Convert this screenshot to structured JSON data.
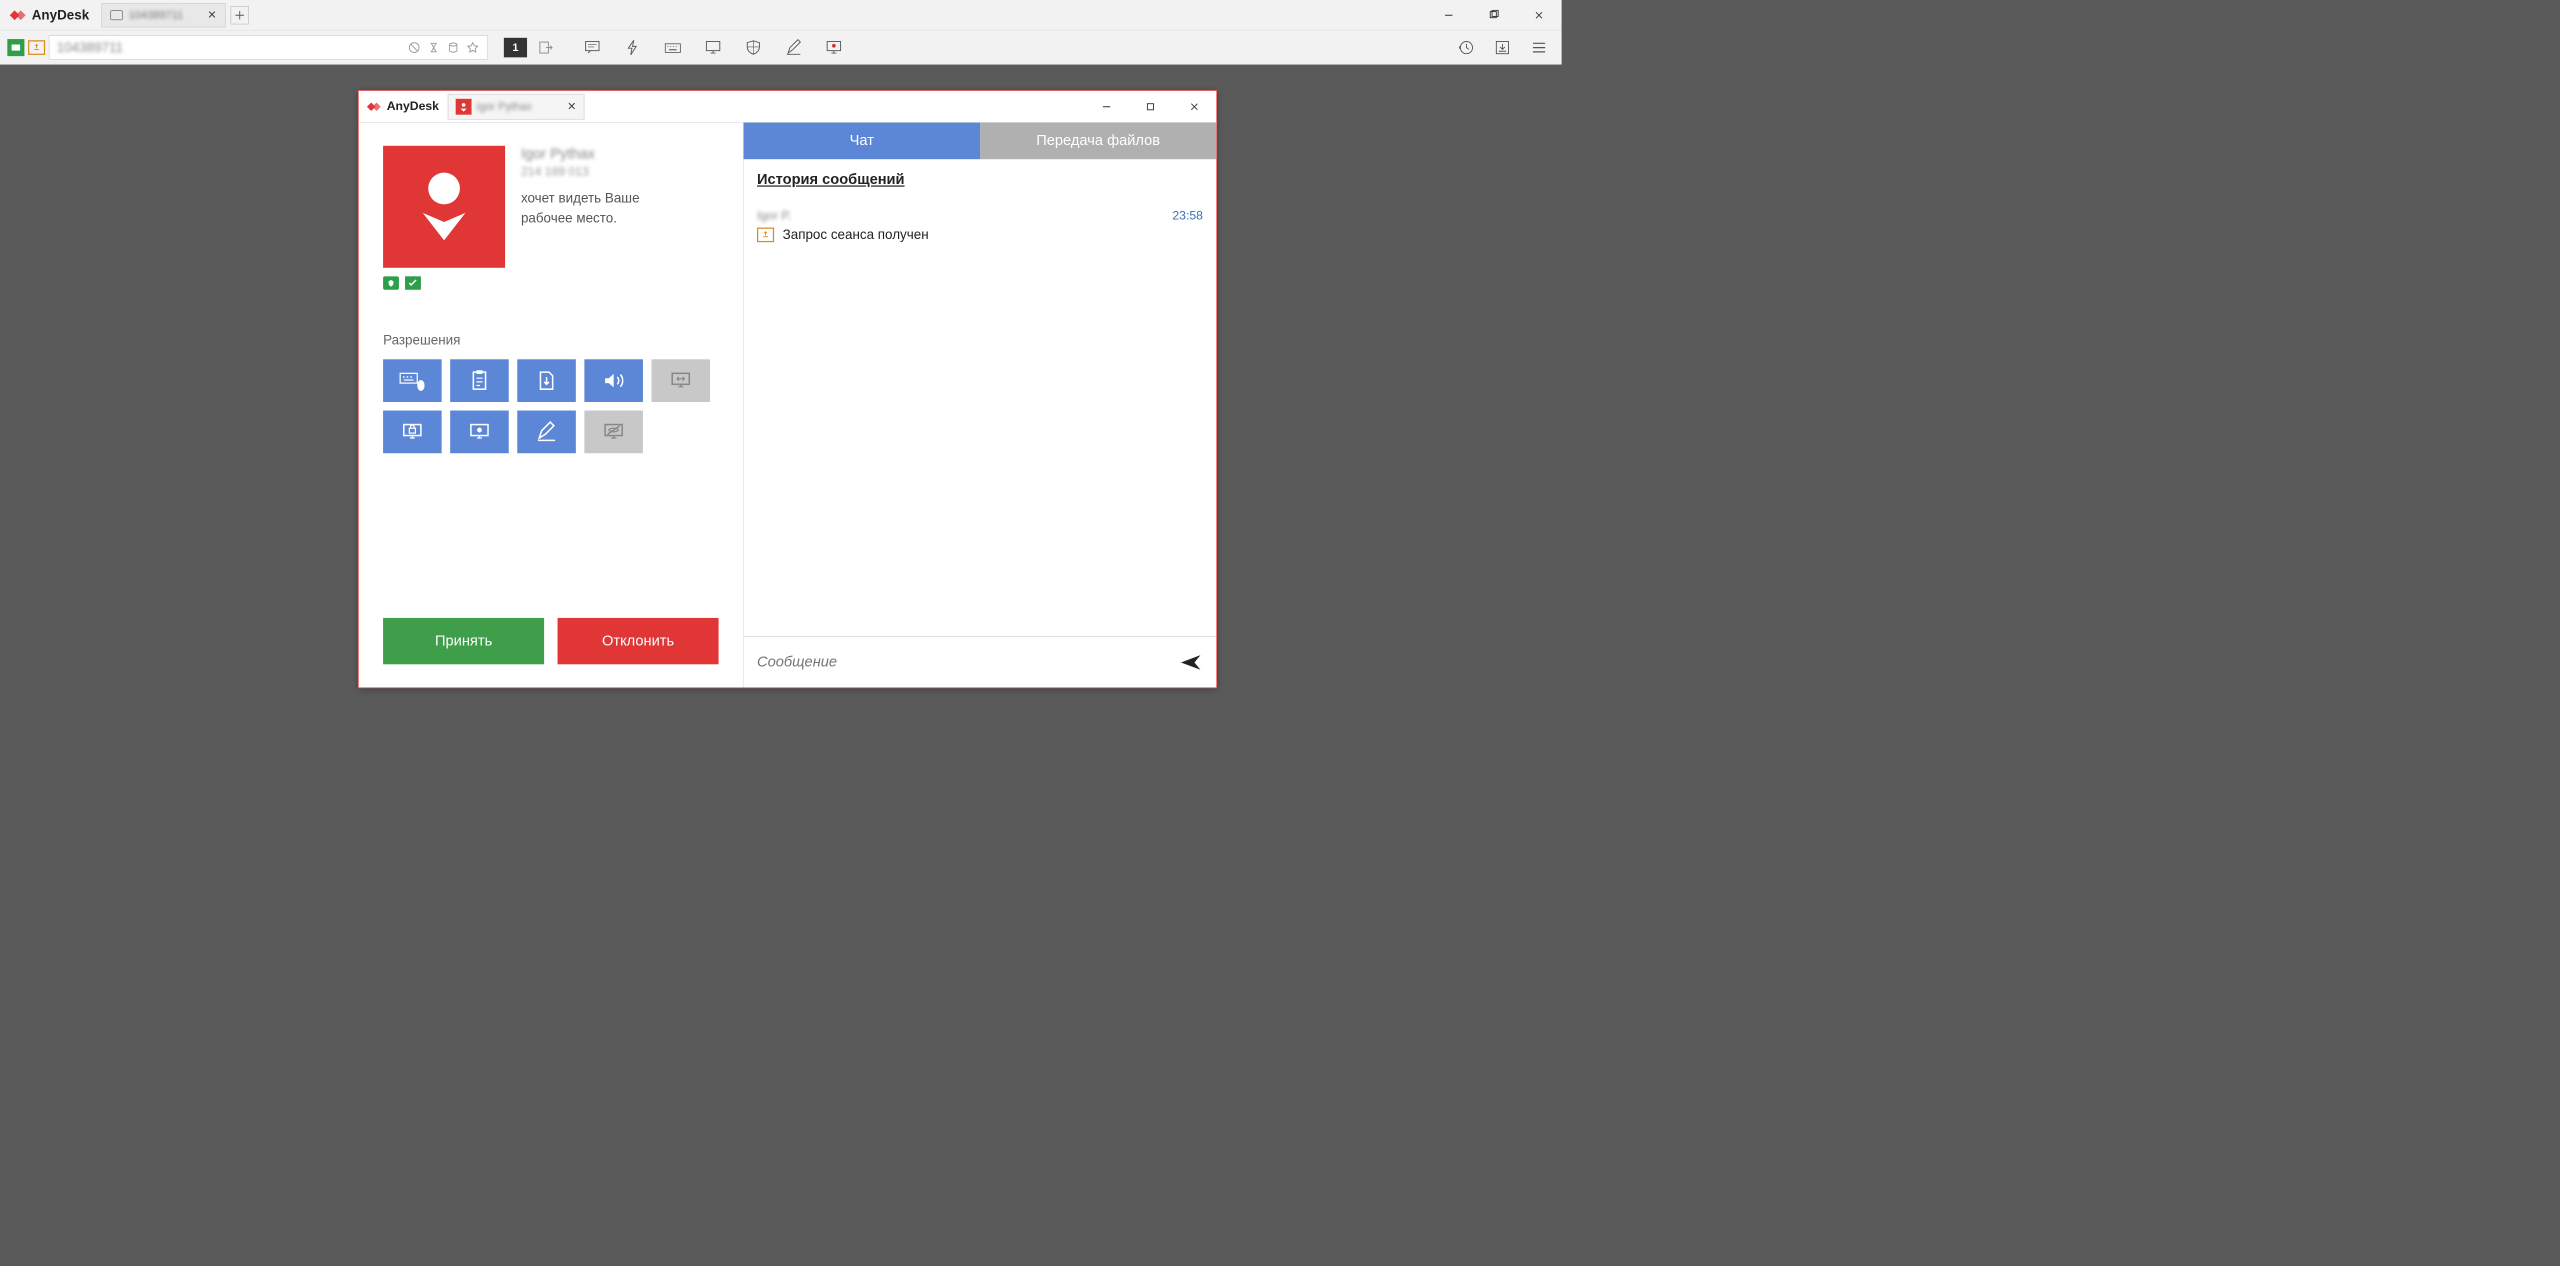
{
  "app": {
    "name": "AnyDesk"
  },
  "mainTab": {
    "label": "104389711",
    "closeGlyph": "✕"
  },
  "address": "104389711",
  "toolbar": {
    "counter": "1"
  },
  "dialog": {
    "appName": "AnyDesk",
    "tabLabel": "Igor Pythax",
    "requester": {
      "name": "Igor Pythax",
      "id": "214 189 013"
    },
    "requestText1": "хочет видеть Ваше",
    "requestText2": "рабочее место.",
    "permissionsTitle": "Разрешения",
    "btnAccept": "Принять",
    "btnDecline": "Отклонить"
  },
  "chat": {
    "tabChat": "Чат",
    "tabFile": "Передача файлов",
    "historyTitle": "История сообщений",
    "msg": {
      "sender": "Igor P.",
      "time": "23:58",
      "text": "Запрос сеанса получен"
    },
    "placeholder": "Сообщение"
  }
}
